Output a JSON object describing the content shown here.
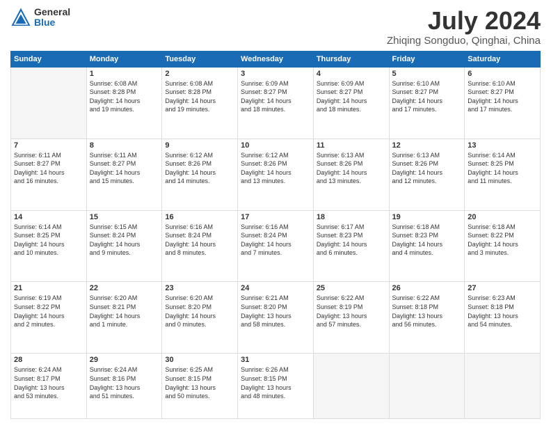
{
  "logo": {
    "general": "General",
    "blue": "Blue"
  },
  "title": "July 2024",
  "subtitle": "Zhiqing Songduo, Qinghai, China",
  "weekdays": [
    "Sunday",
    "Monday",
    "Tuesday",
    "Wednesday",
    "Thursday",
    "Friday",
    "Saturday"
  ],
  "weeks": [
    [
      {
        "day": "",
        "info": ""
      },
      {
        "day": "1",
        "info": "Sunrise: 6:08 AM\nSunset: 8:28 PM\nDaylight: 14 hours\nand 19 minutes."
      },
      {
        "day": "2",
        "info": "Sunrise: 6:08 AM\nSunset: 8:28 PM\nDaylight: 14 hours\nand 19 minutes."
      },
      {
        "day": "3",
        "info": "Sunrise: 6:09 AM\nSunset: 8:27 PM\nDaylight: 14 hours\nand 18 minutes."
      },
      {
        "day": "4",
        "info": "Sunrise: 6:09 AM\nSunset: 8:27 PM\nDaylight: 14 hours\nand 18 minutes."
      },
      {
        "day": "5",
        "info": "Sunrise: 6:10 AM\nSunset: 8:27 PM\nDaylight: 14 hours\nand 17 minutes."
      },
      {
        "day": "6",
        "info": "Sunrise: 6:10 AM\nSunset: 8:27 PM\nDaylight: 14 hours\nand 17 minutes."
      }
    ],
    [
      {
        "day": "7",
        "info": "Sunrise: 6:11 AM\nSunset: 8:27 PM\nDaylight: 14 hours\nand 16 minutes."
      },
      {
        "day": "8",
        "info": "Sunrise: 6:11 AM\nSunset: 8:27 PM\nDaylight: 14 hours\nand 15 minutes."
      },
      {
        "day": "9",
        "info": "Sunrise: 6:12 AM\nSunset: 8:26 PM\nDaylight: 14 hours\nand 14 minutes."
      },
      {
        "day": "10",
        "info": "Sunrise: 6:12 AM\nSunset: 8:26 PM\nDaylight: 14 hours\nand 13 minutes."
      },
      {
        "day": "11",
        "info": "Sunrise: 6:13 AM\nSunset: 8:26 PM\nDaylight: 14 hours\nand 13 minutes."
      },
      {
        "day": "12",
        "info": "Sunrise: 6:13 AM\nSunset: 8:26 PM\nDaylight: 14 hours\nand 12 minutes."
      },
      {
        "day": "13",
        "info": "Sunrise: 6:14 AM\nSunset: 8:25 PM\nDaylight: 14 hours\nand 11 minutes."
      }
    ],
    [
      {
        "day": "14",
        "info": "Sunrise: 6:14 AM\nSunset: 8:25 PM\nDaylight: 14 hours\nand 10 minutes."
      },
      {
        "day": "15",
        "info": "Sunrise: 6:15 AM\nSunset: 8:24 PM\nDaylight: 14 hours\nand 9 minutes."
      },
      {
        "day": "16",
        "info": "Sunrise: 6:16 AM\nSunset: 8:24 PM\nDaylight: 14 hours\nand 8 minutes."
      },
      {
        "day": "17",
        "info": "Sunrise: 6:16 AM\nSunset: 8:24 PM\nDaylight: 14 hours\nand 7 minutes."
      },
      {
        "day": "18",
        "info": "Sunrise: 6:17 AM\nSunset: 8:23 PM\nDaylight: 14 hours\nand 6 minutes."
      },
      {
        "day": "19",
        "info": "Sunrise: 6:18 AM\nSunset: 8:23 PM\nDaylight: 14 hours\nand 4 minutes."
      },
      {
        "day": "20",
        "info": "Sunrise: 6:18 AM\nSunset: 8:22 PM\nDaylight: 14 hours\nand 3 minutes."
      }
    ],
    [
      {
        "day": "21",
        "info": "Sunrise: 6:19 AM\nSunset: 8:22 PM\nDaylight: 14 hours\nand 2 minutes."
      },
      {
        "day": "22",
        "info": "Sunrise: 6:20 AM\nSunset: 8:21 PM\nDaylight: 14 hours\nand 1 minute."
      },
      {
        "day": "23",
        "info": "Sunrise: 6:20 AM\nSunset: 8:20 PM\nDaylight: 14 hours\nand 0 minutes."
      },
      {
        "day": "24",
        "info": "Sunrise: 6:21 AM\nSunset: 8:20 PM\nDaylight: 13 hours\nand 58 minutes."
      },
      {
        "day": "25",
        "info": "Sunrise: 6:22 AM\nSunset: 8:19 PM\nDaylight: 13 hours\nand 57 minutes."
      },
      {
        "day": "26",
        "info": "Sunrise: 6:22 AM\nSunset: 8:18 PM\nDaylight: 13 hours\nand 56 minutes."
      },
      {
        "day": "27",
        "info": "Sunrise: 6:23 AM\nSunset: 8:18 PM\nDaylight: 13 hours\nand 54 minutes."
      }
    ],
    [
      {
        "day": "28",
        "info": "Sunrise: 6:24 AM\nSunset: 8:17 PM\nDaylight: 13 hours\nand 53 minutes."
      },
      {
        "day": "29",
        "info": "Sunrise: 6:24 AM\nSunset: 8:16 PM\nDaylight: 13 hours\nand 51 minutes."
      },
      {
        "day": "30",
        "info": "Sunrise: 6:25 AM\nSunset: 8:15 PM\nDaylight: 13 hours\nand 50 minutes."
      },
      {
        "day": "31",
        "info": "Sunrise: 6:26 AM\nSunset: 8:15 PM\nDaylight: 13 hours\nand 48 minutes."
      },
      {
        "day": "",
        "info": ""
      },
      {
        "day": "",
        "info": ""
      },
      {
        "day": "",
        "info": ""
      }
    ]
  ]
}
